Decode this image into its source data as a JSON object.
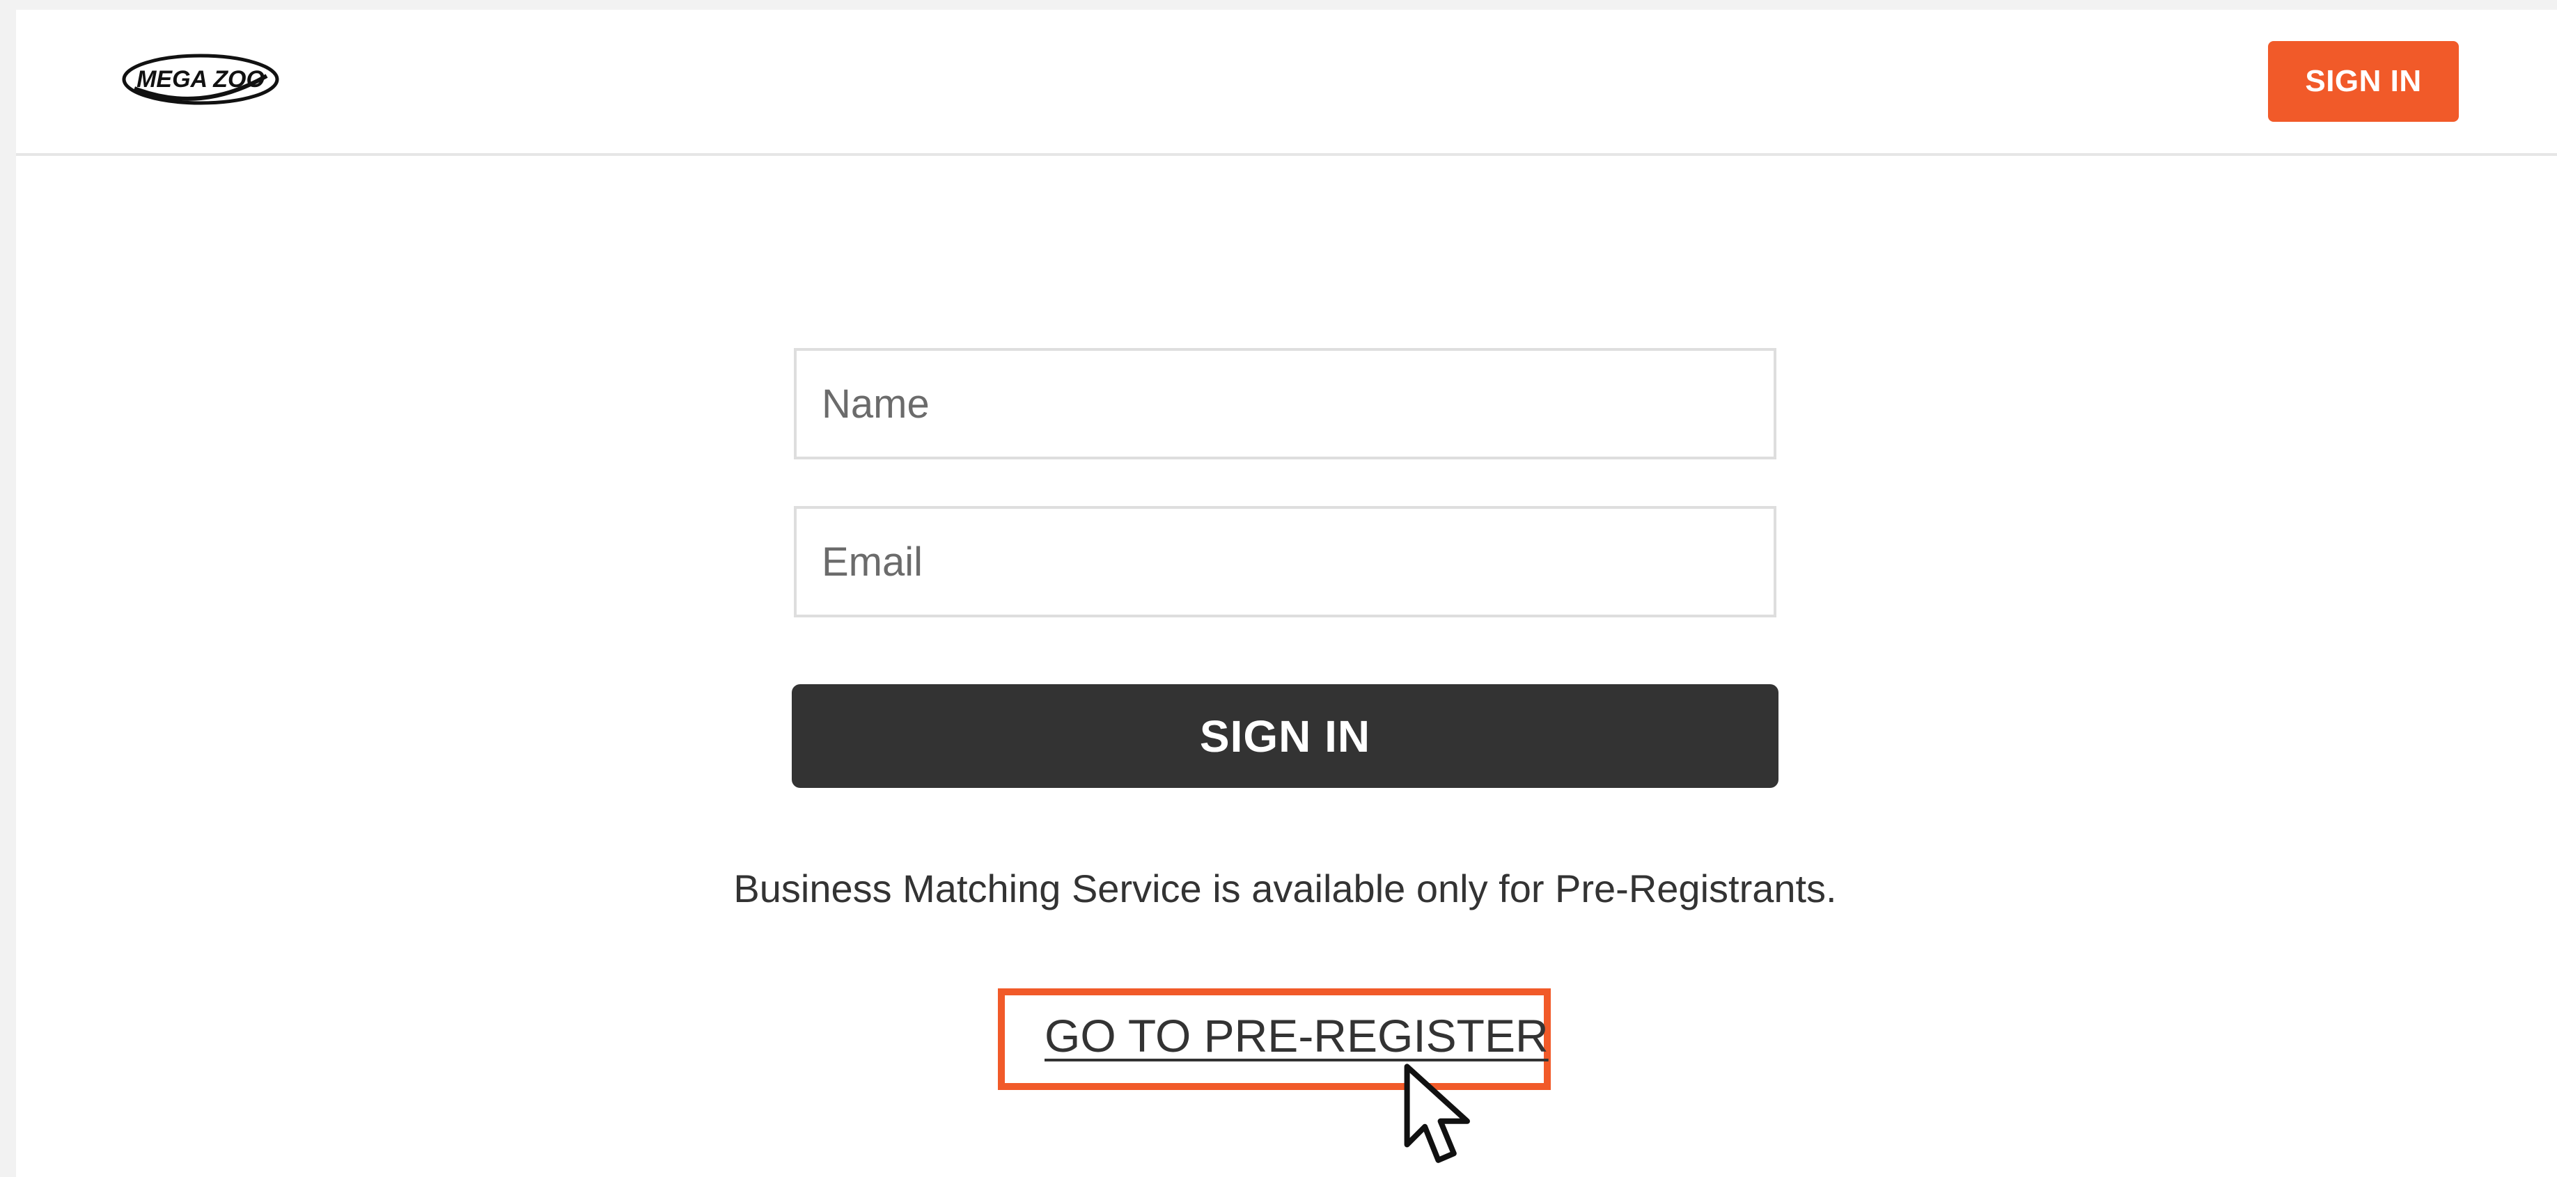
{
  "header": {
    "logo_text": "MEGA ZOO",
    "signin_label": "SIGN IN"
  },
  "form": {
    "name_placeholder": "Name",
    "email_placeholder": "Email",
    "signin_label": "SIGN IN"
  },
  "notice_text": "Business Matching Service is available only for Pre-Registrants.",
  "preregister": {
    "link_label": "GO TO PRE-REGISTER"
  },
  "colors": {
    "accent": "#f15a29",
    "button_dark": "#333333",
    "field_border": "#dedede"
  },
  "icons": {
    "logo": "mega-zoo-logo",
    "pointer": "mouse-pointer-icon"
  }
}
